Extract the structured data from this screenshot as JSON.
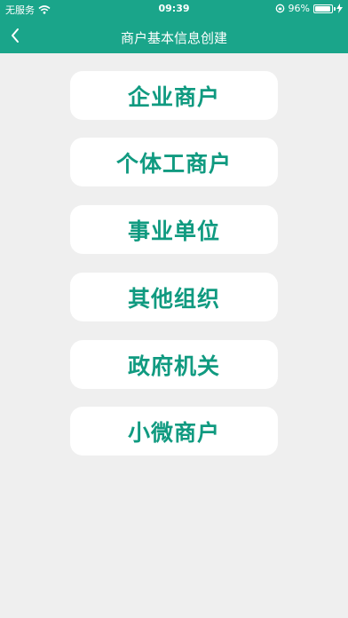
{
  "status_bar": {
    "carrier": "无服务",
    "time": "09:39",
    "battery": "96%",
    "battery_level": 0.96
  },
  "nav": {
    "title": "商户基本信息创建",
    "back_icon": "chevron-left-icon"
  },
  "options": [
    {
      "label": "企业商户"
    },
    {
      "label": "个体工商户"
    },
    {
      "label": "事业单位"
    },
    {
      "label": "其他组织"
    },
    {
      "label": "政府机关"
    },
    {
      "label": "小微商户"
    }
  ],
  "colors": {
    "header": "#1aa58a",
    "option_text": "#109a80",
    "background": "#efefef"
  }
}
